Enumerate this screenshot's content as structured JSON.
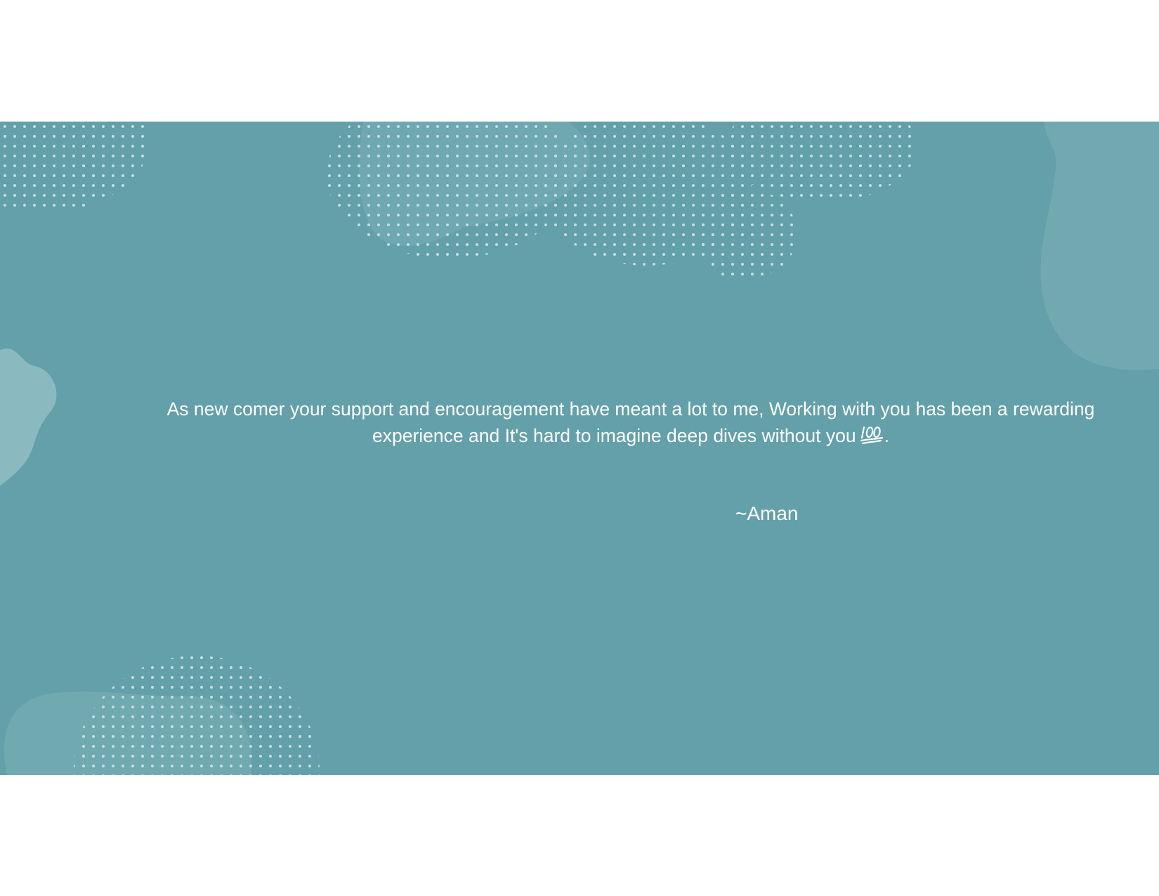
{
  "slide": {
    "background_color": "#63a0a9",
    "message": "As new comer your support and encouragement have meant a lot to me, Working with you has been a rewarding experience and It's hard to imagine deep dives without you",
    "message_end_icon": "hundred-points-emoji-icon",
    "message_end_punctuation": ".",
    "signature": "~Aman"
  }
}
